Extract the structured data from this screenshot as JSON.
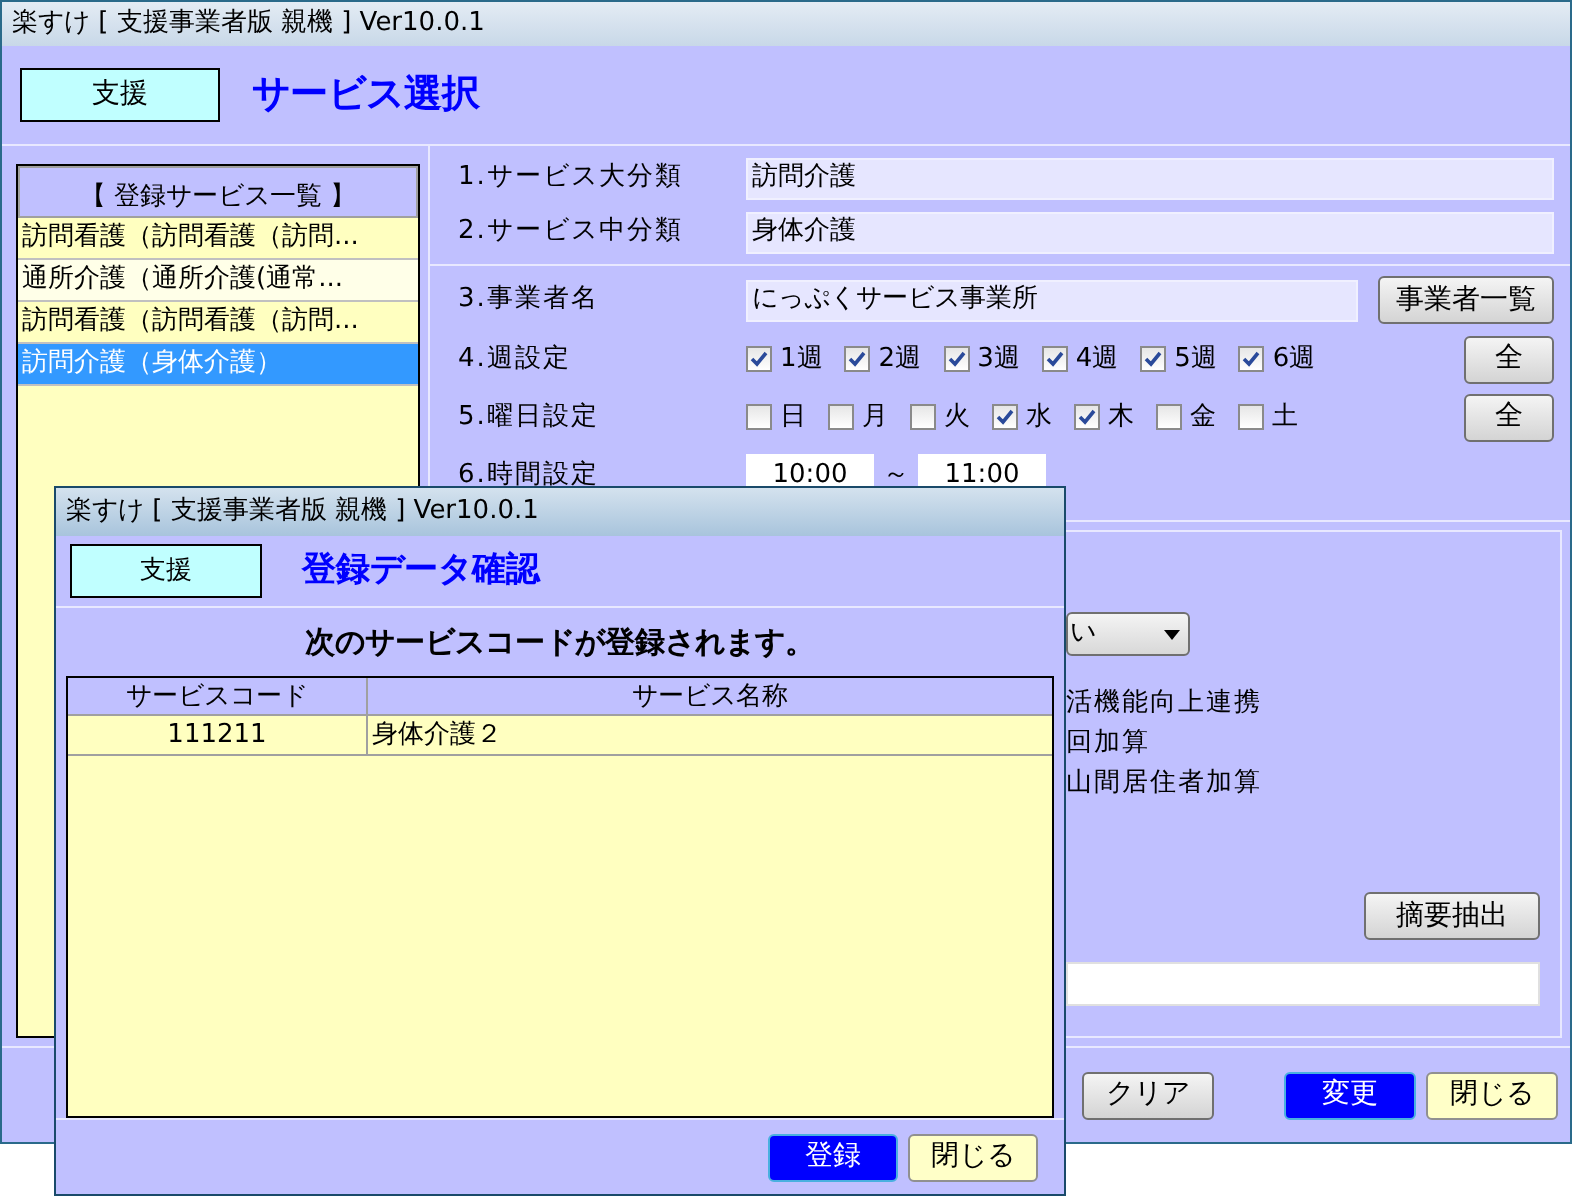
{
  "window": {
    "title": "楽すけ [ 支援事業者版 親機 ] Ver10.0.1"
  },
  "header": {
    "badge": "支援",
    "title": "サービス選択"
  },
  "service_list": {
    "heading": "【 登録サービス一覧 】",
    "items": [
      {
        "label": "訪問看護（訪問看護（訪問...",
        "selected": false
      },
      {
        "label": "通所介護（通所介護(通常...",
        "selected": false
      },
      {
        "label": "訪問看護（訪問看護（訪問...",
        "selected": false
      },
      {
        "label": "訪問介護（身体介護）",
        "selected": true
      }
    ]
  },
  "classification": [
    {
      "label": "1.サービス大分類",
      "value": "訪問介護"
    },
    {
      "label": "2.サービス中分類",
      "value": "身体介護"
    }
  ],
  "provider": {
    "label": "3.事業者名",
    "value": "にっぷくサービス事業所",
    "button": "事業者一覧"
  },
  "weeks": {
    "label": "4.週設定",
    "button": "全",
    "options": [
      {
        "label": "1週",
        "checked": true
      },
      {
        "label": "2週",
        "checked": true
      },
      {
        "label": "3週",
        "checked": true
      },
      {
        "label": "4週",
        "checked": true
      },
      {
        "label": "5週",
        "checked": true
      },
      {
        "label": "6週",
        "checked": true
      }
    ]
  },
  "weekdays": {
    "label": "5.曜日設定",
    "button": "全",
    "options": [
      {
        "label": "日",
        "checked": false
      },
      {
        "label": "月",
        "checked": false
      },
      {
        "label": "火",
        "checked": false
      },
      {
        "label": "水",
        "checked": true
      },
      {
        "label": "木",
        "checked": true
      },
      {
        "label": "金",
        "checked": false
      },
      {
        "label": "土",
        "checked": false
      }
    ]
  },
  "time": {
    "label": "6.時間設定",
    "start": "10:00",
    "separator": "～",
    "end": "11:00"
  },
  "dropdown": {
    "value": "い"
  },
  "additions": [
    "活機能向上連携",
    "回加算",
    "山間居住者加算"
  ],
  "summary_button": "摘要抽出",
  "footer_buttons": [
    {
      "label": "クリア",
      "kind": "normal"
    },
    {
      "label": "変更",
      "kind": "primary"
    },
    {
      "label": "閉じる",
      "kind": "close"
    }
  ],
  "dialog": {
    "title": "楽すけ [ 支援事業者版 親機 ] Ver10.0.1",
    "badge": "支援",
    "heading": "登録データ確認",
    "message": "次のサービスコードが登録されます。",
    "table": {
      "columns": [
        "サービスコード",
        "サービス名称"
      ],
      "rows": [
        [
          "111211",
          "身体介護２"
        ]
      ]
    },
    "buttons": [
      {
        "label": "登録",
        "kind": "primary"
      },
      {
        "label": "閉じる",
        "kind": "close"
      }
    ]
  }
}
